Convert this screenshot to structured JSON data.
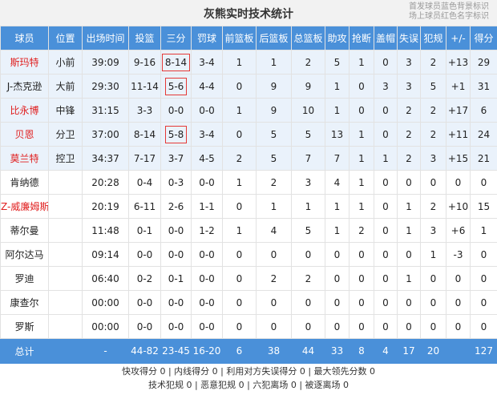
{
  "title": "灰熊实时技术统计",
  "legend": {
    "line1": "首发球员蓝色背景标识",
    "line2": "场上球员红色名字标识"
  },
  "headers": [
    "球员",
    "位置",
    "出场时间",
    "投篮",
    "三分",
    "罚球",
    "前篮板",
    "后篮板",
    "总篮板",
    "助攻",
    "抢断",
    "盖帽",
    "失误",
    "犯规",
    "+/-",
    "得分"
  ],
  "players": [
    {
      "name": "斯玛特",
      "pos": "小前",
      "min": "39:09",
      "fg": "9-16",
      "tp": "8-14",
      "ft": "3-4",
      "oreb": "1",
      "dreb": "1",
      "reb": "2",
      "ast": "5",
      "stl": "1",
      "blk": "0",
      "tov": "3",
      "pf": "2",
      "pm": "+13",
      "pts": "29"
    },
    {
      "name": "J-杰克逊",
      "pos": "大前",
      "min": "29:30",
      "fg": "11-14",
      "tp": "5-6",
      "ft": "4-4",
      "oreb": "0",
      "dreb": "9",
      "reb": "9",
      "ast": "1",
      "stl": "0",
      "blk": "3",
      "tov": "3",
      "pf": "5",
      "pm": "+1",
      "pts": "31"
    },
    {
      "name": "比永博",
      "pos": "中锋",
      "min": "31:15",
      "fg": "3-3",
      "tp": "0-0",
      "ft": "0-0",
      "oreb": "1",
      "dreb": "9",
      "reb": "10",
      "ast": "1",
      "stl": "0",
      "blk": "0",
      "tov": "2",
      "pf": "2",
      "pm": "+17",
      "pts": "6"
    },
    {
      "name": "贝恩",
      "pos": "分卫",
      "min": "37:00",
      "fg": "8-14",
      "tp": "5-8",
      "ft": "3-4",
      "oreb": "0",
      "dreb": "5",
      "reb": "5",
      "ast": "13",
      "stl": "1",
      "blk": "0",
      "tov": "2",
      "pf": "2",
      "pm": "+11",
      "pts": "24"
    },
    {
      "name": "莫兰特",
      "pos": "控卫",
      "min": "34:37",
      "fg": "7-17",
      "tp": "3-7",
      "ft": "4-5",
      "oreb": "2",
      "dreb": "5",
      "reb": "7",
      "ast": "7",
      "stl": "1",
      "blk": "1",
      "tov": "2",
      "pf": "3",
      "pm": "+15",
      "pts": "21"
    },
    {
      "name": "肯纳德",
      "pos": "",
      "min": "20:28",
      "fg": "0-4",
      "tp": "0-3",
      "ft": "0-0",
      "oreb": "1",
      "dreb": "2",
      "reb": "3",
      "ast": "4",
      "stl": "1",
      "blk": "0",
      "tov": "0",
      "pf": "0",
      "pm": "0",
      "pts": "0"
    },
    {
      "name": "Z-威廉姆斯",
      "pos": "",
      "min": "20:19",
      "fg": "6-11",
      "tp": "2-6",
      "ft": "1-1",
      "oreb": "0",
      "dreb": "1",
      "reb": "1",
      "ast": "1",
      "stl": "1",
      "blk": "0",
      "tov": "1",
      "pf": "2",
      "pm": "+10",
      "pts": "15"
    },
    {
      "name": "蒂尔曼",
      "pos": "",
      "min": "11:48",
      "fg": "0-1",
      "tp": "0-0",
      "ft": "1-2",
      "oreb": "1",
      "dreb": "4",
      "reb": "5",
      "ast": "1",
      "stl": "2",
      "blk": "0",
      "tov": "1",
      "pf": "3",
      "pm": "+6",
      "pts": "1"
    },
    {
      "name": "阿尔达马",
      "pos": "",
      "min": "09:14",
      "fg": "0-0",
      "tp": "0-0",
      "ft": "0-0",
      "oreb": "0",
      "dreb": "0",
      "reb": "0",
      "ast": "0",
      "stl": "0",
      "blk": "0",
      "tov": "0",
      "pf": "1",
      "pm": "-3",
      "pts": "0"
    },
    {
      "name": "罗迪",
      "pos": "",
      "min": "06:40",
      "fg": "0-2",
      "tp": "0-1",
      "ft": "0-0",
      "oreb": "0",
      "dreb": "2",
      "reb": "2",
      "ast": "0",
      "stl": "0",
      "blk": "0",
      "tov": "1",
      "pf": "0",
      "pm": "0",
      "pts": "0"
    },
    {
      "name": "康查尔",
      "pos": "",
      "min": "00:00",
      "fg": "0-0",
      "tp": "0-0",
      "ft": "0-0",
      "oreb": "0",
      "dreb": "0",
      "reb": "0",
      "ast": "0",
      "stl": "0",
      "blk": "0",
      "tov": "0",
      "pf": "0",
      "pm": "0",
      "pts": "0"
    },
    {
      "name": "罗斯",
      "pos": "",
      "min": "00:00",
      "fg": "0-0",
      "tp": "0-0",
      "ft": "0-0",
      "oreb": "0",
      "dreb": "0",
      "reb": "0",
      "ast": "0",
      "stl": "0",
      "blk": "0",
      "tov": "0",
      "pf": "0",
      "pm": "0",
      "pts": "0"
    }
  ],
  "totals": {
    "name": "总计",
    "pos": "",
    "min": "-",
    "fg": "44-82",
    "tp": "23-45",
    "ft": "16-20",
    "oreb": "6",
    "dreb": "38",
    "reb": "44",
    "ast": "33",
    "stl": "8",
    "blk": "4",
    "tov": "17",
    "pf": "20",
    "pm": "",
    "pts": "127"
  },
  "footer": {
    "line1": "快攻得分 0 | 内线得分 0 | 利用对方失误得分 0 | 最大领先分数 0",
    "line2": "技术犯规 0 | 恶意犯规 0 | 六犯离场 0 | 被逐离场 0"
  },
  "colors": {
    "header_bg": "#4a90d9",
    "starter_bg": "#eaf2fb",
    "on_court_name": "#e02020",
    "highlight_border": "#e53935"
  }
}
